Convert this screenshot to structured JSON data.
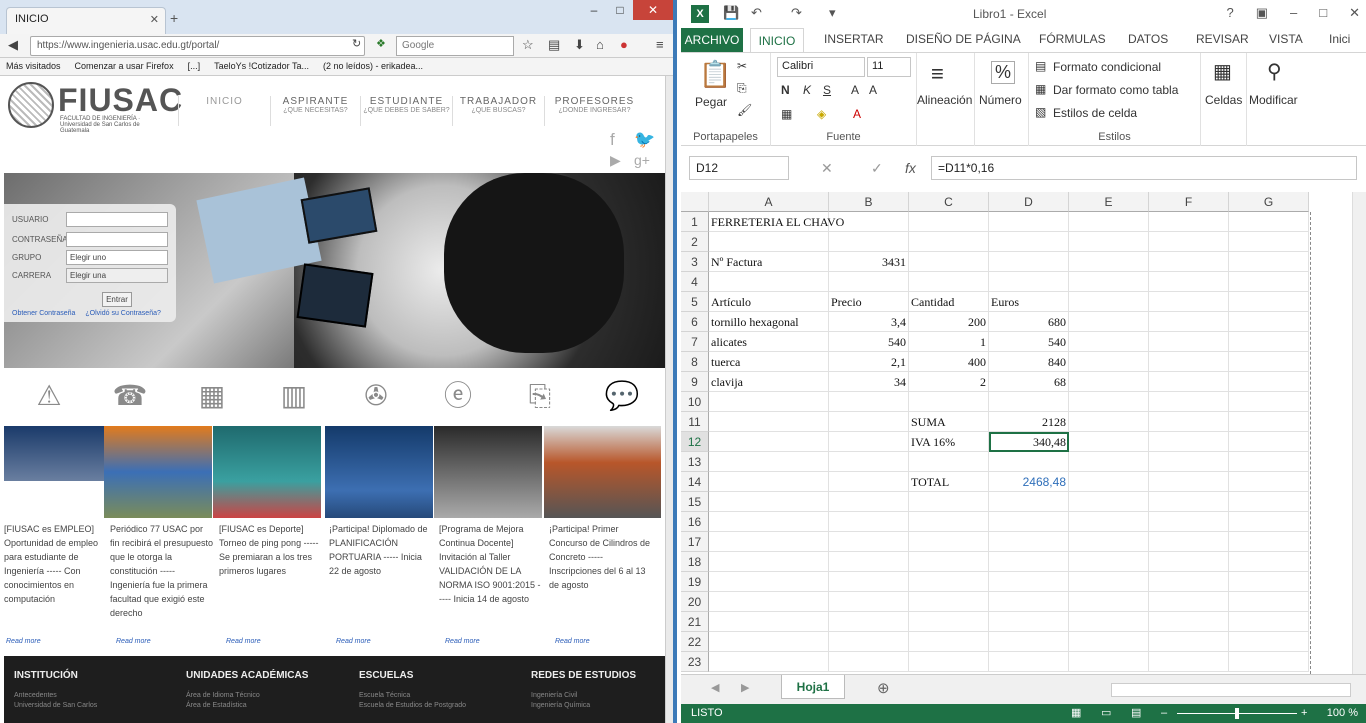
{
  "firefox": {
    "tab_title": "INICIO",
    "url": "https://www.ingenieria.usac.edu.gt/portal/",
    "search_placeholder": "Google",
    "bookmarks": [
      "Más visitados",
      "Comenzar a usar Firefox",
      "[...]",
      "TaeloYs !Cotizador Ta...",
      "(2 no leídos) - erikadea..."
    ]
  },
  "site": {
    "logo_name": "FIUSAC",
    "logo_sub": "FACULTAD DE INGENIERÍA · Universidad de San Carlos de Guatemala",
    "menu": [
      {
        "label": "INICIO",
        "sub": ""
      },
      {
        "label": "ASPIRANTE",
        "sub": "¿QUE NECESITAS?"
      },
      {
        "label": "ESTUDIANTE",
        "sub": "¿QUE DEBES DE SABER?"
      },
      {
        "label": "TRABAJADOR",
        "sub": "¿QUE BUSCAS?"
      },
      {
        "label": "PROFESORES",
        "sub": "¿DONDE INGRESAR?"
      }
    ],
    "login": {
      "usuario": "USUARIO",
      "contrasena": "CONTRASEÑA",
      "grupo": "GRUPO",
      "grupo_value": "Elegir uno",
      "carrera": "CARRERA",
      "carrera_value": "Elegir una",
      "button": "Entrar",
      "link1": "Obtener Contraseña",
      "link2": "¿Olvidó su Contraseña?"
    },
    "news": [
      {
        "text": "[FIUSAC es EMPLEO] Oportunidad de empleo para estudiante de Ingeniería ----- Con conocimientos en computación",
        "more": "Read more"
      },
      {
        "text": "Periódico 77 USAC por fin recibirá el presupuesto que le otorga la constitución ----- Ingeniería fue la primera facultad que exigió este derecho",
        "more": "Read more"
      },
      {
        "text": "[FIUSAC es Deporte] Torneo de ping pong ----- Se premiaran a los tres primeros lugares",
        "more": "Read more"
      },
      {
        "text": "¡Participa! Diplomado de PLANIFICACIÓN PORTUARIA ----- Inicia 22 de agosto",
        "more": "Read more"
      },
      {
        "text": "[Programa de Mejora Continua Docente] Invitación al Taller VALIDACIÓN DE LA NORMA ISO 9001:2015 ----- Inicia 14 de agosto",
        "more": "Read more"
      },
      {
        "text": "¡Participa! Primer Concurso de Cilindros de Concreto ----- Inscripciones del 6 al 13 de agosto",
        "more": "Read more"
      }
    ],
    "footer": [
      {
        "title": "INSTITUCIÓN",
        "items": [
          "Antecedentes",
          "Universidad de San Carlos"
        ]
      },
      {
        "title": "UNIDADES ACADÉMICAS",
        "items": [
          "Área de Idioma Técnico",
          "Área de Estadística"
        ]
      },
      {
        "title": "ESCUELAS",
        "items": [
          "Escuela Técnica",
          "Escuela de Estudios de Postgrado"
        ]
      },
      {
        "title": "REDES DE ESTUDIOS",
        "items": [
          "Ingeniería Civil",
          "Ingeniería Química"
        ]
      }
    ]
  },
  "excel": {
    "title": "Libro1 - Excel",
    "tabs": [
      "ARCHIVO",
      "INICIO",
      "INSERTAR",
      "DISEÑO DE PÁGINA",
      "FÓRMULAS",
      "DATOS",
      "REVISAR",
      "VISTA",
      "Inici"
    ],
    "ribbon": {
      "pegar": "Pegar",
      "portapapeles": "Portapapeles",
      "font": "Calibri",
      "size": "11",
      "fuente": "Fuente",
      "alineacion": "Alineación",
      "numero": "Número",
      "fmt_cond": "Formato condicional",
      "fmt_tabla": "Dar formato como tabla",
      "estilos_celda": "Estilos de celda",
      "estilos": "Estilos",
      "celdas": "Celdas",
      "modificar": "Modificar"
    },
    "namebox": "D12",
    "formula": "=D11*0,16",
    "columns": [
      "A",
      "B",
      "C",
      "D",
      "E",
      "F",
      "G"
    ],
    "rows": [
      "1",
      "2",
      "3",
      "4",
      "5",
      "6",
      "7",
      "8",
      "9",
      "10",
      "11",
      "12",
      "13",
      "14",
      "15",
      "16",
      "17",
      "18",
      "19",
      "20",
      "21",
      "22",
      "23"
    ],
    "cells": {
      "A1": "FERRETERIA EL CHAVO",
      "A3": "Nº Factura",
      "B3": "3431",
      "A5": "Artículo",
      "B5": "Precio",
      "C5": "Cantidad",
      "D5": "Euros",
      "A6": "tornillo hexagonal",
      "B6": "3,4",
      "C6": "200",
      "D6": "680",
      "A7": "alicates",
      "B7": "540",
      "C7": "1",
      "D7": "540",
      "A8": "tuerca",
      "B8": "2,1",
      "C8": "400",
      "D8": "840",
      "A9": "clavija",
      "B9": "34",
      "C9": "2",
      "D9": "68",
      "C11": "SUMA",
      "D11": "2128",
      "C12": "IVA 16%",
      "D12": "340,48",
      "C14": "TOTAL",
      "D14": "2468,48"
    },
    "sheet": "Hoja1",
    "status": "LISTO",
    "zoom": "100 %"
  }
}
